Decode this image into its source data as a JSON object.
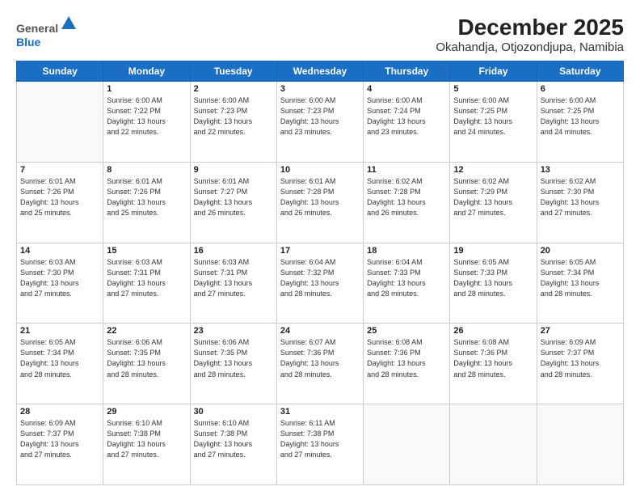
{
  "logo": {
    "general": "General",
    "blue": "Blue"
  },
  "title": "December 2025",
  "subtitle": "Okahandja, Otjozondjupa, Namibia",
  "headers": [
    "Sunday",
    "Monday",
    "Tuesday",
    "Wednesday",
    "Thursday",
    "Friday",
    "Saturday"
  ],
  "weeks": [
    [
      {
        "day": "",
        "info": ""
      },
      {
        "day": "1",
        "info": "Sunrise: 6:00 AM\nSunset: 7:22 PM\nDaylight: 13 hours\nand 22 minutes."
      },
      {
        "day": "2",
        "info": "Sunrise: 6:00 AM\nSunset: 7:23 PM\nDaylight: 13 hours\nand 22 minutes."
      },
      {
        "day": "3",
        "info": "Sunrise: 6:00 AM\nSunset: 7:23 PM\nDaylight: 13 hours\nand 23 minutes."
      },
      {
        "day": "4",
        "info": "Sunrise: 6:00 AM\nSunset: 7:24 PM\nDaylight: 13 hours\nand 23 minutes."
      },
      {
        "day": "5",
        "info": "Sunrise: 6:00 AM\nSunset: 7:25 PM\nDaylight: 13 hours\nand 24 minutes."
      },
      {
        "day": "6",
        "info": "Sunrise: 6:00 AM\nSunset: 7:25 PM\nDaylight: 13 hours\nand 24 minutes."
      }
    ],
    [
      {
        "day": "7",
        "info": "Sunrise: 6:01 AM\nSunset: 7:26 PM\nDaylight: 13 hours\nand 25 minutes."
      },
      {
        "day": "8",
        "info": "Sunrise: 6:01 AM\nSunset: 7:26 PM\nDaylight: 13 hours\nand 25 minutes."
      },
      {
        "day": "9",
        "info": "Sunrise: 6:01 AM\nSunset: 7:27 PM\nDaylight: 13 hours\nand 26 minutes."
      },
      {
        "day": "10",
        "info": "Sunrise: 6:01 AM\nSunset: 7:28 PM\nDaylight: 13 hours\nand 26 minutes."
      },
      {
        "day": "11",
        "info": "Sunrise: 6:02 AM\nSunset: 7:28 PM\nDaylight: 13 hours\nand 26 minutes."
      },
      {
        "day": "12",
        "info": "Sunrise: 6:02 AM\nSunset: 7:29 PM\nDaylight: 13 hours\nand 27 minutes."
      },
      {
        "day": "13",
        "info": "Sunrise: 6:02 AM\nSunset: 7:30 PM\nDaylight: 13 hours\nand 27 minutes."
      }
    ],
    [
      {
        "day": "14",
        "info": "Sunrise: 6:03 AM\nSunset: 7:30 PM\nDaylight: 13 hours\nand 27 minutes."
      },
      {
        "day": "15",
        "info": "Sunrise: 6:03 AM\nSunset: 7:31 PM\nDaylight: 13 hours\nand 27 minutes."
      },
      {
        "day": "16",
        "info": "Sunrise: 6:03 AM\nSunset: 7:31 PM\nDaylight: 13 hours\nand 27 minutes."
      },
      {
        "day": "17",
        "info": "Sunrise: 6:04 AM\nSunset: 7:32 PM\nDaylight: 13 hours\nand 28 minutes."
      },
      {
        "day": "18",
        "info": "Sunrise: 6:04 AM\nSunset: 7:33 PM\nDaylight: 13 hours\nand 28 minutes."
      },
      {
        "day": "19",
        "info": "Sunrise: 6:05 AM\nSunset: 7:33 PM\nDaylight: 13 hours\nand 28 minutes."
      },
      {
        "day": "20",
        "info": "Sunrise: 6:05 AM\nSunset: 7:34 PM\nDaylight: 13 hours\nand 28 minutes."
      }
    ],
    [
      {
        "day": "21",
        "info": "Sunrise: 6:05 AM\nSunset: 7:34 PM\nDaylight: 13 hours\nand 28 minutes."
      },
      {
        "day": "22",
        "info": "Sunrise: 6:06 AM\nSunset: 7:35 PM\nDaylight: 13 hours\nand 28 minutes."
      },
      {
        "day": "23",
        "info": "Sunrise: 6:06 AM\nSunset: 7:35 PM\nDaylight: 13 hours\nand 28 minutes."
      },
      {
        "day": "24",
        "info": "Sunrise: 6:07 AM\nSunset: 7:36 PM\nDaylight: 13 hours\nand 28 minutes."
      },
      {
        "day": "25",
        "info": "Sunrise: 6:08 AM\nSunset: 7:36 PM\nDaylight: 13 hours\nand 28 minutes."
      },
      {
        "day": "26",
        "info": "Sunrise: 6:08 AM\nSunset: 7:36 PM\nDaylight: 13 hours\nand 28 minutes."
      },
      {
        "day": "27",
        "info": "Sunrise: 6:09 AM\nSunset: 7:37 PM\nDaylight: 13 hours\nand 28 minutes."
      }
    ],
    [
      {
        "day": "28",
        "info": "Sunrise: 6:09 AM\nSunset: 7:37 PM\nDaylight: 13 hours\nand 27 minutes."
      },
      {
        "day": "29",
        "info": "Sunrise: 6:10 AM\nSunset: 7:38 PM\nDaylight: 13 hours\nand 27 minutes."
      },
      {
        "day": "30",
        "info": "Sunrise: 6:10 AM\nSunset: 7:38 PM\nDaylight: 13 hours\nand 27 minutes."
      },
      {
        "day": "31",
        "info": "Sunrise: 6:11 AM\nSunset: 7:38 PM\nDaylight: 13 hours\nand 27 minutes."
      },
      {
        "day": "",
        "info": ""
      },
      {
        "day": "",
        "info": ""
      },
      {
        "day": "",
        "info": ""
      }
    ]
  ]
}
